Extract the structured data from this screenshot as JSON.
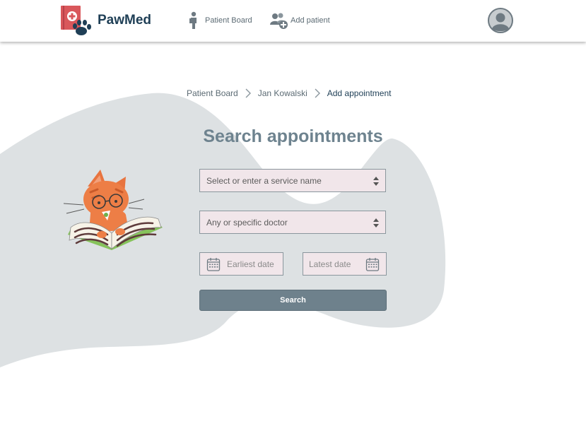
{
  "app": {
    "name": "PawMed"
  },
  "nav": {
    "patient_board": {
      "label": "Patient Board",
      "icon": "person-icon"
    },
    "add_patient": {
      "label": "Add patient",
      "icon": "add-user-icon"
    },
    "avatar_icon": "user-avatar-icon"
  },
  "breadcrumb": [
    "Patient Board",
    "Jan Kowalski",
    "Add appointment"
  ],
  "page": {
    "title": "Search appointments"
  },
  "form": {
    "service": {
      "placeholder": "Select or enter a service name"
    },
    "doctor": {
      "placeholder": "Any or specific doctor"
    },
    "earliest_date": {
      "placeholder": "Earliest date"
    },
    "latest_date": {
      "placeholder": "Latest date"
    },
    "search_label": "Search"
  },
  "colors": {
    "brand": "#1f3f56",
    "muted_text": "#5c6b74",
    "title": "#6e838f",
    "button": "#6e818c",
    "field_bg": "#f1e6ea",
    "blob": "#dde1e3"
  }
}
